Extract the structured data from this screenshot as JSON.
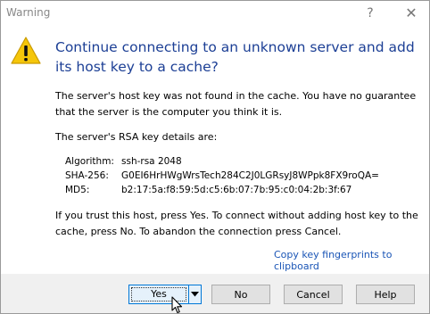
{
  "window": {
    "title": "Warning",
    "help_glyph": "?",
    "close_glyph": "✕"
  },
  "icons": {
    "warning": "warning-icon",
    "help": "question-mark-icon",
    "close": "close-icon",
    "dropdown": "chevron-down-icon",
    "cursor": "mouse-pointer-icon"
  },
  "dialog": {
    "instruction": "Continue connecting to an unknown server and add its host key to a cache?",
    "paragraph1": "The server's host key was not found in the cache. You have no guarantee that the server is the computer you think it is.",
    "paragraph2": "The server's RSA key details are:",
    "key_details": [
      {
        "label": "Algorithm:",
        "value": "ssh-rsa 2048"
      },
      {
        "label": "SHA-256:",
        "value": "G0EI6HrHWgWrsTech284C2J0LGRsyJ8WPpk8FX9roQA="
      },
      {
        "label": "MD5:",
        "value": "b2:17:5a:f8:59:5d:c5:6b:07:7b:95:c0:04:2b:3f:67"
      }
    ],
    "paragraph3": "If you trust this host, press Yes. To connect without adding host key to the cache, press No. To abandon the connection press Cancel.",
    "copy_link": "Copy key fingerprints to clipboard"
  },
  "buttons": {
    "yes": "Yes",
    "no": "No",
    "cancel": "Cancel",
    "help": "Help"
  },
  "colors": {
    "instruction_text": "#1c3f95",
    "link": "#1a55b6",
    "warning_fill": "#f5c60a",
    "focus_border": "#0078d7",
    "footer_bg": "#f0f0f0"
  }
}
